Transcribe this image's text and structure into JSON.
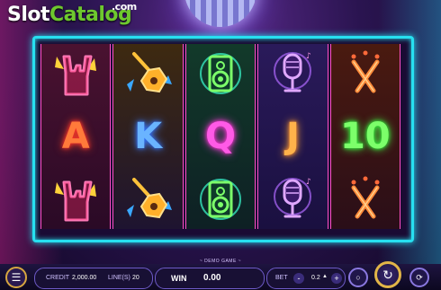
{
  "logo": {
    "slot": "Slot",
    "catalog": "Catalog",
    "com": ".com"
  },
  "reels": [
    [
      "rock-hand-icon",
      "A",
      "rock-hand-icon"
    ],
    [
      "guitar-icon",
      "K",
      "guitar-icon"
    ],
    [
      "speaker-icon",
      "Q",
      "speaker-icon"
    ],
    [
      "microphone-icon",
      "J",
      "microphone-icon"
    ],
    [
      "drumsticks-icon",
      "10",
      "drumsticks-icon"
    ]
  ],
  "demo_text": "~ DEMO GAME ~",
  "credit": {
    "label": "CREDIT",
    "value": "2,000.00"
  },
  "lines": {
    "label": "LINE(S)",
    "value": "20"
  },
  "win": {
    "label": "WIN",
    "value": "0.00"
  },
  "bet": {
    "label": "BET",
    "value": "0.2",
    "minus": "-",
    "plus": "+"
  },
  "colors": {
    "frame": "#27e0f0",
    "reel_divider": "#ff4fc7",
    "spin_ring": "#e2b548",
    "logo_green": "#6ec82e"
  }
}
